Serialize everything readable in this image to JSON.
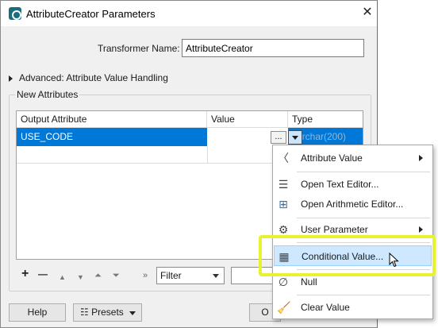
{
  "window": {
    "title": "AttributeCreator Parameters"
  },
  "form": {
    "transformer_name_label": "Transformer Name:",
    "transformer_name_value": "AttributeCreator",
    "advanced_label": "Advanced: Attribute Value Handling",
    "group_title": "New Attributes"
  },
  "table": {
    "columns": [
      "Output Attribute",
      "Value",
      "Type"
    ],
    "rows": [
      {
        "output_attribute": "USE_CODE",
        "value": "",
        "type": "varchar(200)"
      }
    ],
    "dots_label": "..."
  },
  "toolbar": {
    "add": "+",
    "remove": "—",
    "move_up": "▲",
    "move_down": "▼",
    "move_top": "⏶",
    "move_bottom": "⏷",
    "expand": "»",
    "filter_value": "Filter"
  },
  "buttons": {
    "help": "Help",
    "presets": "Presets",
    "ok": "O"
  },
  "menu": {
    "items": [
      {
        "label": "Attribute Value",
        "icon": "attribute-value-icon",
        "glyph": "〈",
        "submenu": true
      },
      {
        "label": "Open Text Editor...",
        "icon": "text-editor-icon",
        "glyph": "☰",
        "submenu": false
      },
      {
        "label": "Open Arithmetic Editor...",
        "icon": "arithmetic-editor-icon",
        "glyph": "⊞",
        "submenu": false
      },
      {
        "label": "User Parameter",
        "icon": "user-parameter-icon",
        "glyph": "⚙",
        "submenu": true
      },
      {
        "label": "Conditional Value...",
        "icon": "conditional-value-icon",
        "glyph": "▦",
        "submenu": false,
        "highlighted": true
      },
      {
        "label": "Null",
        "icon": "null-icon",
        "glyph": "∅",
        "submenu": false
      },
      {
        "label": "Clear Value",
        "icon": "clear-value-icon",
        "glyph": "🧹",
        "submenu": false
      }
    ]
  },
  "colors": {
    "selection": "#0078d7",
    "highlight_box": "#e9f231",
    "menu_hover": "#cde8ff"
  }
}
